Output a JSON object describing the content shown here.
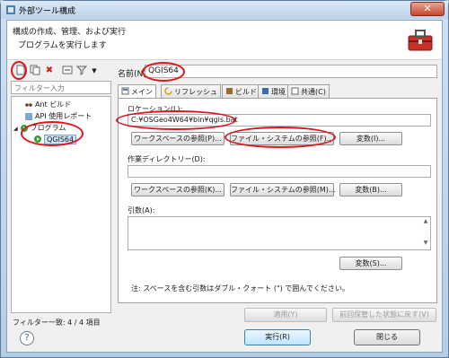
{
  "window": {
    "title": "外部ツール構成",
    "close_glyph": "✕"
  },
  "header": {
    "title": "構成の作成、管理、および実行",
    "description": "プログラムを実行します",
    "icon": "toolbox-icon"
  },
  "left": {
    "filter_placeholder": "フィルター入力",
    "tree": [
      {
        "label": "Ant ビルド",
        "icon": "ant-icon"
      },
      {
        "label": "API 使用レポート",
        "icon": "report-icon"
      },
      {
        "label": "プログラム",
        "icon": "program-icon",
        "expanded": true
      },
      {
        "label": "QGIS64",
        "icon": "program-icon",
        "selected": true
      }
    ],
    "status": "フィルター一致: 4 / 4 項目"
  },
  "main": {
    "name_label": "名前(N):",
    "name_value": "QGIS64",
    "tabs": [
      {
        "label": "メイン",
        "active": true
      },
      {
        "label": "リフレッシュ"
      },
      {
        "label": "ビルド"
      },
      {
        "label": "環境"
      },
      {
        "label": "共通(C)"
      }
    ],
    "location": {
      "label": "ロケーション(L):",
      "value": "C:¥OSGeo4W64¥bin¥qgis.bat",
      "workspace_btn": "ワークスペースの参照(P)...",
      "filesystem_btn": "ファイル・システムの参照(F)...",
      "variables_btn": "変数(I)..."
    },
    "workdir": {
      "label": "作業ディレクトリー(D):",
      "value": "",
      "workspace_btn": "ワークスペースの参照(K)...",
      "filesystem_btn": "ファイル・システムの参照(M)...",
      "variables_btn": "変数(B)..."
    },
    "args": {
      "label": "引数(A):",
      "value": "",
      "variables_btn": "変数(S)..."
    },
    "note": "注: スペースを含む引数はダブル・クォート (\") で囲んでください。",
    "apply_btn": "適用(Y)",
    "revert_btn": "前回保管した状態に戻す(V)"
  },
  "footer": {
    "help_glyph": "?",
    "run_btn": "実行(R)",
    "close_btn": "閉じる"
  },
  "colors": {
    "annotation": "#e0121a",
    "selection": "#cde3f7"
  }
}
